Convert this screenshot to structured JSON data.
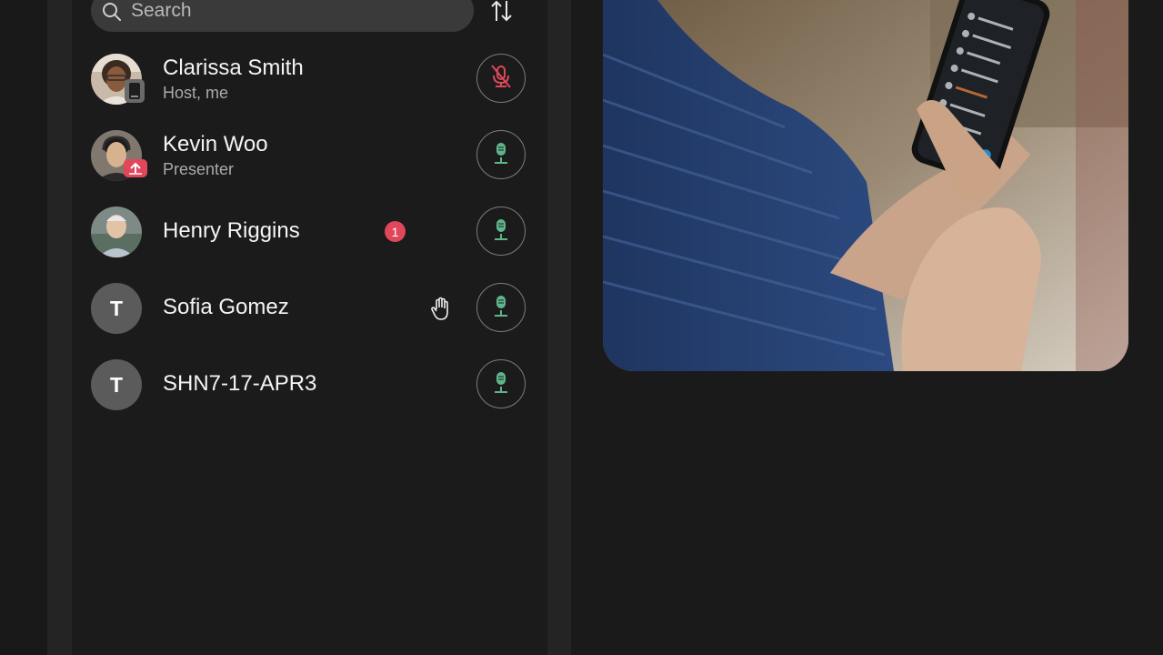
{
  "search": {
    "placeholder": "Search"
  },
  "participants": [
    {
      "name": "Clarissa Smith",
      "subtitle": "Host, me",
      "mic": "muted",
      "avatar": "photo",
      "device_badge": "phone-icon"
    },
    {
      "name": "Kevin Woo",
      "subtitle": "Presenter",
      "mic": "unmuted",
      "avatar": "photo",
      "device_badge": "share-screen-icon"
    },
    {
      "name": "Henry Riggins",
      "mic": "unmuted",
      "avatar": "photo",
      "notification_count": "1"
    },
    {
      "name": "Sofia Gomez",
      "mic": "unmuted",
      "avatar": "initial",
      "initial": "T",
      "raised_hand": true
    },
    {
      "name": "SHN7-17-APR3",
      "mic": "unmuted",
      "avatar": "initial",
      "initial": "T"
    }
  ],
  "colors": {
    "mic_unmuted": "#5fb58a",
    "mic_muted": "#e0475b",
    "notification": "#e0475b",
    "panel_bg": "#1b1b1b",
    "search_bg": "#3a3a3a"
  }
}
